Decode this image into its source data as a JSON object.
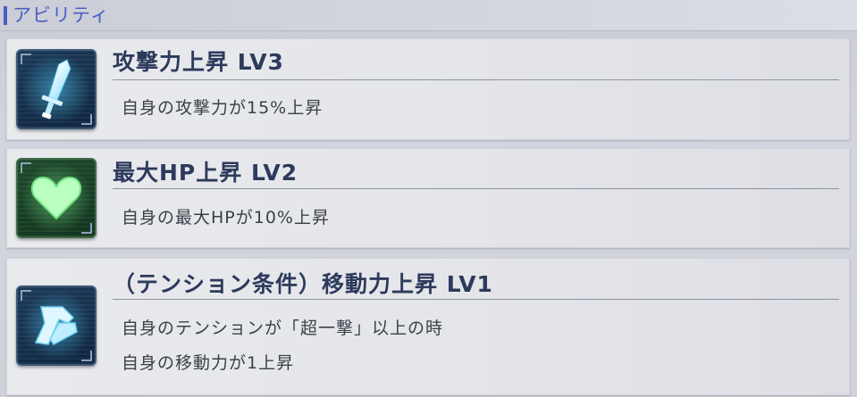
{
  "header": {
    "title": "アビリティ"
  },
  "abilities": [
    {
      "icon": "sword-icon",
      "title": "攻撃力上昇 LV3",
      "description": [
        "自身の攻撃力が15%上昇"
      ]
    },
    {
      "icon": "heart-icon",
      "title": "最大HP上昇 LV2",
      "description": [
        "自身の最大HPが10%上昇"
      ]
    },
    {
      "icon": "boot-icon",
      "title": "（テンション条件）移動力上昇 LV1",
      "description": [
        "自身のテンションが「超一撃」以上の時",
        "自身の移動力が1上昇"
      ]
    }
  ],
  "colors": {
    "accent": "#4b5fc4",
    "title_text": "#2d3a5c",
    "body_text": "#3b4048",
    "icon_blue": "#1b3a58",
    "icon_green": "#1e4a2c"
  }
}
